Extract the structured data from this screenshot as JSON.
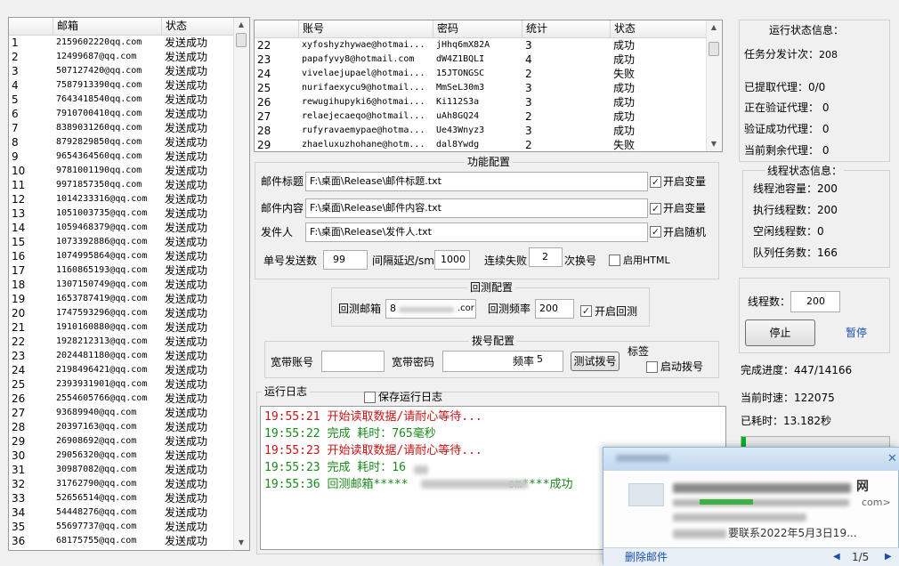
{
  "left_table": {
    "headers": [
      "",
      "邮箱",
      "状态"
    ],
    "rows": [
      [
        "1",
        "2159602220qq.com",
        "发送成功"
      ],
      [
        "2",
        "12499687@qq.com",
        "发送成功"
      ],
      [
        "3",
        "507127420@qq.com",
        "发送成功"
      ],
      [
        "4",
        "7587913390qq.com",
        "发送成功"
      ],
      [
        "5",
        "7643418540qq.com",
        "发送成功"
      ],
      [
        "6",
        "7910700410qq.com",
        "发送成功"
      ],
      [
        "7",
        "8389031260qq.com",
        "发送成功"
      ],
      [
        "8",
        "8792829850qq.com",
        "发送成功"
      ],
      [
        "9",
        "9654364560qq.com",
        "发送成功"
      ],
      [
        "10",
        "9781001190qq.com",
        "发送成功"
      ],
      [
        "11",
        "9971857350qq.com",
        "发送成功"
      ],
      [
        "12",
        "1014233316@qq.com",
        "发送成功"
      ],
      [
        "13",
        "1051003735@qq.com",
        "发送成功"
      ],
      [
        "14",
        "1059468379@qq.com",
        "发送成功"
      ],
      [
        "15",
        "1073392886@qq.com",
        "发送成功"
      ],
      [
        "16",
        "1074995864@qq.com",
        "发送成功"
      ],
      [
        "17",
        "1160865193@qq.com",
        "发送成功"
      ],
      [
        "18",
        "1307150749@qq.com",
        "发送成功"
      ],
      [
        "19",
        "1653787419@qq.com",
        "发送成功"
      ],
      [
        "20",
        "1747593296@qq.com",
        "发送成功"
      ],
      [
        "21",
        "1910160880@qq.com",
        "发送成功"
      ],
      [
        "22",
        "1928212313@qq.com",
        "发送成功"
      ],
      [
        "23",
        "2024481180@qq.com",
        "发送成功"
      ],
      [
        "24",
        "2198496421@qq.com",
        "发送成功"
      ],
      [
        "25",
        "2393931901@qq.com",
        "发送成功"
      ],
      [
        "26",
        "2554605766@qq.com",
        "发送成功"
      ],
      [
        "27",
        "93689940@qq.com",
        "发送成功"
      ],
      [
        "28",
        "20397163@qq.com",
        "发送成功"
      ],
      [
        "29",
        "26908692@qq.com",
        "发送成功"
      ],
      [
        "30",
        "29056320@qq.com",
        "发送成功"
      ],
      [
        "31",
        "30987082@qq.com",
        "发送成功"
      ],
      [
        "32",
        "31762790@qq.com",
        "发送成功"
      ],
      [
        "33",
        "52656514@qq.com",
        "发送成功"
      ],
      [
        "34",
        "54448276@qq.com",
        "发送成功"
      ],
      [
        "35",
        "55697737@qq.com",
        "发送成功"
      ],
      [
        "36",
        "68175755@qq.com",
        "发送成功"
      ]
    ]
  },
  "account_table": {
    "headers": [
      "",
      "账号",
      "密码",
      "统计",
      "状态"
    ],
    "rows": [
      [
        "22",
        "xyfoshyzhywae@hotmai...",
        "jHhq6mX82A",
        "3",
        "成功"
      ],
      [
        "23",
        "papafyvy8@hotmail.com",
        "dW4Z1BQLI",
        "4",
        "成功"
      ],
      [
        "24",
        "vivelaejupael@hotmai...",
        "15JTONGSC",
        "2",
        "失败"
      ],
      [
        "25",
        "nurifaexycu9@hotmail...",
        "MmSeL30m3",
        "3",
        "成功"
      ],
      [
        "26",
        "rewugihupyki6@hotmai...",
        "Ki112S3a",
        "3",
        "成功"
      ],
      [
        "27",
        "relaejecaeqo@hotmail...",
        "uAh8GQ24",
        "2",
        "成功"
      ],
      [
        "28",
        "rufyravaemypae@hotma...",
        "Ue43Wnyz3",
        "3",
        "成功"
      ],
      [
        "29",
        "zhaeluxuzhohane@hotm...",
        "dal8Ywdg",
        "2",
        "失败"
      ]
    ]
  },
  "func_config": {
    "title": "功能配置",
    "subject_label": "邮件标题",
    "subject_value": "F:\\桌面\\Release\\邮件标题.txt",
    "subject_check": "开启变量",
    "content_label": "邮件内容",
    "content_value": "F:\\桌面\\Release\\邮件内容.txt",
    "content_check": "开启变量",
    "sender_label": "发件人",
    "sender_value": "F:\\桌面\\Release\\发件人.txt",
    "sender_check": "开启随机",
    "per_send_label": "单号发送数",
    "per_send_value": "99",
    "interval_label": "间隔延迟/sm",
    "interval_value": "1000",
    "fail_label": "连续失败",
    "fail_value": "2",
    "fail_suffix": "次换号",
    "html_check": "启用HTML"
  },
  "echo_config": {
    "title": "回测配置",
    "mail_label": "回测邮箱",
    "mail_prefix": "8",
    "mail_suffix": ".cor",
    "freq_label": "回测频率",
    "freq_value": "200",
    "enable_check": "开启回测"
  },
  "dial_config": {
    "title": "拨号配置",
    "account_label": "宽带账号",
    "account_value": "",
    "password_label": "宽带密码",
    "password_value": "",
    "freq_label": "频率",
    "freq_value": "5",
    "test_button": "测试拨号",
    "tag_label": "标签",
    "enable_check": "启动拨号"
  },
  "log": {
    "title": "运行日志",
    "save_check": "保存运行日志",
    "lines": [
      {
        "time": "19:55:21",
        "text": "开始读取数据/请耐心等待...",
        "color": "#c81414"
      },
      {
        "time": "19:55:22",
        "text": "完成 耗时：765毫秒",
        "color": "#1a8a1a"
      },
      {
        "time": "19:55:23",
        "text": "开始读取数据/请耐心等待...",
        "color": "#c81414"
      },
      {
        "time": "19:55:23",
        "text": "完成 耗时：16",
        "color": "#1a8a1a"
      },
      {
        "time": "19:55:36",
        "text": "回测邮箱*****",
        "suffix": "om****成功",
        "color": "#1a8a1a"
      }
    ]
  },
  "run_status": {
    "title": "运行状态信息：",
    "task_label": "任务分发计次：",
    "task_value": "208",
    "extracted": "已提取代理：0/0",
    "verifying": "正在验证代理： 0",
    "verified": "验证成功代理： 0",
    "remaining": "当前剩余代理： 0"
  },
  "thread_status": {
    "title": "线程状态信息：",
    "pool": "线程池容量：200",
    "exec": "执行线程数：200",
    "idle": "空闲线程数：0",
    "queue": "队列任务数：166"
  },
  "controls": {
    "thread_label": "线程数：",
    "thread_value": "200",
    "stop_button": "停止",
    "pause_link": "暂停",
    "progress": "完成进度：447/14166",
    "speed": "当前时速：122075",
    "elapsed": "已耗时：13.182秒",
    "progress_fraction": 0.032
  },
  "notification": {
    "title_suffix": "网",
    "body_suffix": "com>",
    "date_text": "要联系2022年5月3日19...",
    "delete_label": "删除邮件",
    "page": "1/5",
    "accent": "#3c8fd6"
  }
}
